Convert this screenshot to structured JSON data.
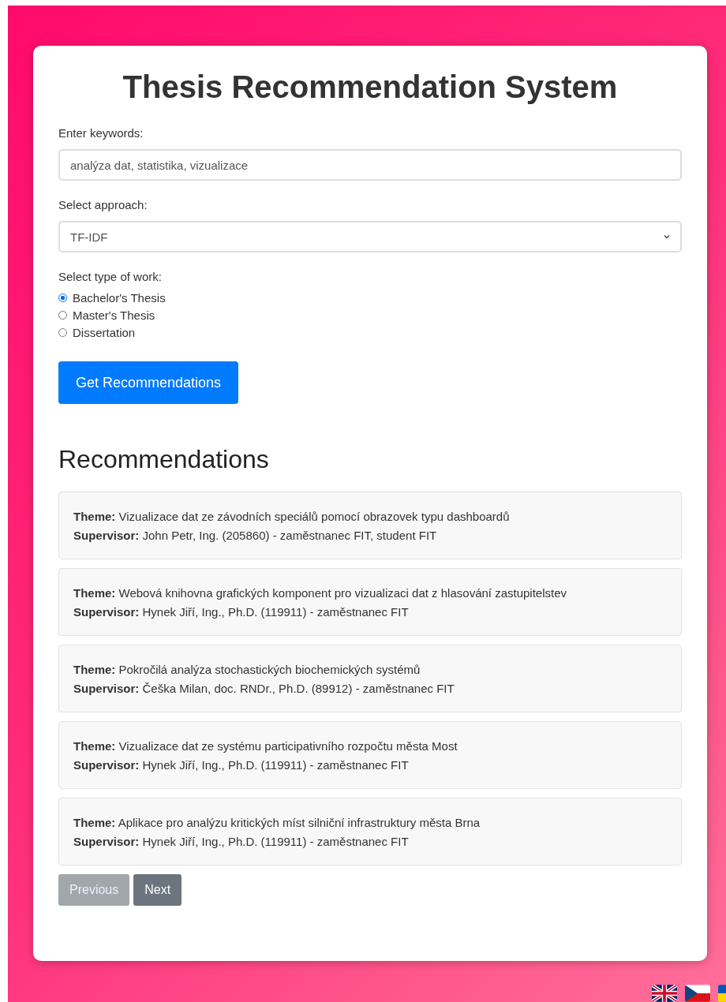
{
  "title": "Thesis Recommendation System",
  "keywords": {
    "label": "Enter keywords:",
    "value": "analýza dat, statistika, vizualizace"
  },
  "approach": {
    "label": "Select approach:",
    "value": "TF-IDF"
  },
  "work_type": {
    "label": "Select type of work:",
    "options": [
      {
        "label": "Bachelor's Thesis",
        "selected": true
      },
      {
        "label": "Master's Thesis",
        "selected": false
      },
      {
        "label": "Dissertation",
        "selected": false
      }
    ]
  },
  "submit_button": "Get Recommendations",
  "recommendations": {
    "heading": "Recommendations",
    "items": [
      {
        "theme": "**Theme:** Vizualizace dat ze závodních speciálů pomocí obrazovek typu dashboardů",
        "supervisor": "**Supervisor:** John Petr, Ing. (205860) - zaměstnanec FIT, student FIT"
      },
      {
        "theme": "**Theme:** Webová knihovna grafických komponent pro vizualizaci dat z hlasování zastupitelstev",
        "supervisor": "**Supervisor:** Hynek Jiří, Ing., Ph.D. (119911) - zaměstnanec FIT"
      },
      {
        "theme": "**Theme:** Pokročilá analýza stochastických biochemických systémů",
        "supervisor": "**Supervisor:** Češka Milan, doc. RNDr., Ph.D. (89912) - zaměstnanec FIT"
      },
      {
        "theme": "**Theme:** Vizualizace dat ze systému participativního rozpočtu města Most",
        "supervisor": "**Supervisor:** Hynek Jiří, Ing., Ph.D. (119911) - zaměstnanec FIT"
      },
      {
        "theme": "**Theme:** Aplikace pro analýzu kritických míst silniční infrastruktury města Brna",
        "supervisor": "**Supervisor:** Hynek Jiří, Ing., Ph.D. (119911) - zaměstnanec FIT"
      }
    ]
  },
  "pagination": [
    {
      "label": "Previous",
      "disabled": true
    },
    {
      "label": "Next",
      "disabled": false
    }
  ],
  "language_flags": [
    {
      "kind": "uk"
    },
    {
      "kind": "cz"
    },
    {
      "kind": "ua"
    }
  ]
}
